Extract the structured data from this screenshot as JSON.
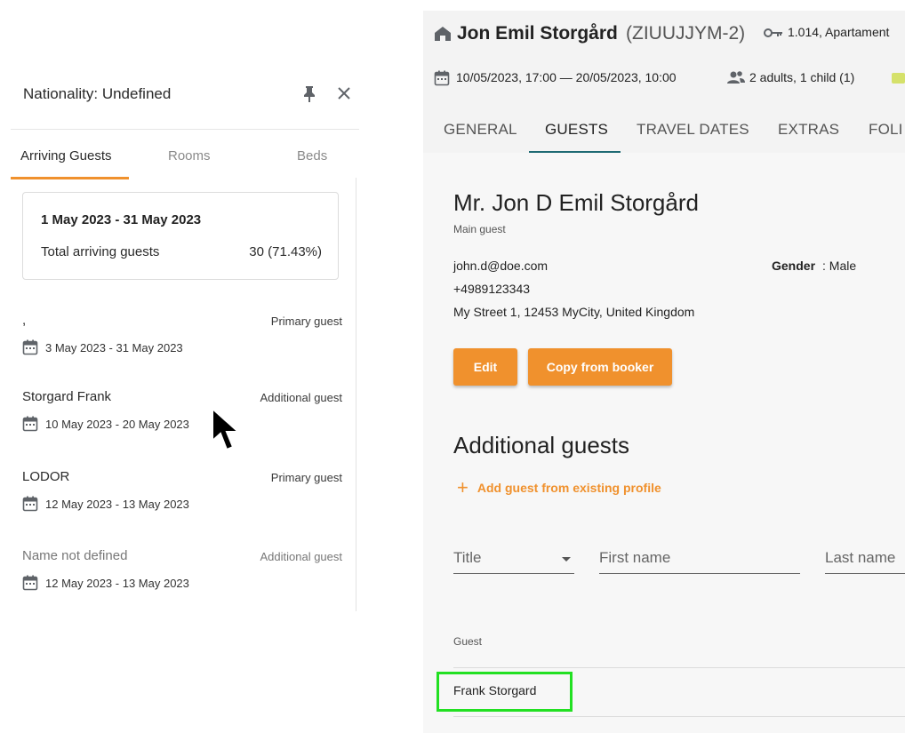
{
  "left_panel": {
    "title": "Nationality: Undefined",
    "tabs": [
      {
        "label": "Arriving Guests",
        "active": true
      },
      {
        "label": "Rooms",
        "active": false
      },
      {
        "label": "Beds",
        "active": false
      }
    ],
    "summary": {
      "range": "1 May 2023 - 31 May 2023",
      "label": "Total arriving guests",
      "value": "30 (71.43%)"
    },
    "guests": [
      {
        "name": ",",
        "type": "Primary guest",
        "dates": "3 May 2023 - 31 May 2023"
      },
      {
        "name": "Storgard Frank",
        "type": "Additional guest",
        "dates": "10 May 2023 - 20 May 2023"
      },
      {
        "name": "LODOR",
        "type": "Primary guest",
        "dates": "12 May 2023 - 13 May 2023"
      },
      {
        "name": "Name not defined",
        "type": "Additional guest",
        "dates": "12 May 2023 - 13 May 2023"
      }
    ]
  },
  "reservation": {
    "guest_name": "Jon Emil Storgård",
    "booking_code": "(ZIUUJJYM-2)",
    "room": "1.014, Apartament",
    "dates": "10/05/2023, 17:00 — 20/05/2023, 10:00",
    "occupancy": "2 adults, 1 child (1)",
    "tabs": [
      {
        "label": "GENERAL",
        "active": false
      },
      {
        "label": "GUESTS",
        "active": true
      },
      {
        "label": "TRAVEL DATES",
        "active": false
      },
      {
        "label": "EXTRAS",
        "active": false
      },
      {
        "label": "FOLI",
        "active": false
      }
    ]
  },
  "main_guest": {
    "name": "Mr. Jon D Emil Storgård",
    "label": "Main guest",
    "email": "john.d@doe.com",
    "phone": "+4989123343",
    "address": "My Street 1, 12453 MyCity, United Kingdom",
    "gender_label": "Gender",
    "gender_value": ": Male",
    "edit_label": "Edit",
    "copy_label": "Copy from booker"
  },
  "additional": {
    "heading": "Additional guests",
    "add_link": "Add guest from existing profile",
    "title_placeholder": "Title",
    "first_placeholder": "First name",
    "last_placeholder": "Last name",
    "column_header": "Guest",
    "rows": [
      "Frank Storgard"
    ]
  },
  "colors": {
    "accent": "#f0912d",
    "tab_indicator": "#1f6a73",
    "highlight": "#22e022"
  }
}
